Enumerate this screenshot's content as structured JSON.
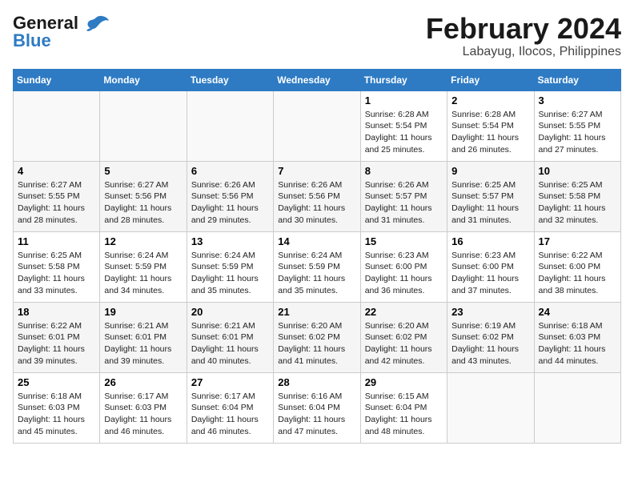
{
  "header": {
    "logo_line1": "General",
    "logo_line2": "Blue",
    "month": "February 2024",
    "location": "Labayug, Ilocos, Philippines"
  },
  "weekdays": [
    "Sunday",
    "Monday",
    "Tuesday",
    "Wednesday",
    "Thursday",
    "Friday",
    "Saturday"
  ],
  "weeks": [
    [
      {
        "day": "",
        "info": ""
      },
      {
        "day": "",
        "info": ""
      },
      {
        "day": "",
        "info": ""
      },
      {
        "day": "",
        "info": ""
      },
      {
        "day": "1",
        "info": "Sunrise: 6:28 AM\nSunset: 5:54 PM\nDaylight: 11 hours and 25 minutes."
      },
      {
        "day": "2",
        "info": "Sunrise: 6:28 AM\nSunset: 5:54 PM\nDaylight: 11 hours and 26 minutes."
      },
      {
        "day": "3",
        "info": "Sunrise: 6:27 AM\nSunset: 5:55 PM\nDaylight: 11 hours and 27 minutes."
      }
    ],
    [
      {
        "day": "4",
        "info": "Sunrise: 6:27 AM\nSunset: 5:55 PM\nDaylight: 11 hours and 28 minutes."
      },
      {
        "day": "5",
        "info": "Sunrise: 6:27 AM\nSunset: 5:56 PM\nDaylight: 11 hours and 28 minutes."
      },
      {
        "day": "6",
        "info": "Sunrise: 6:26 AM\nSunset: 5:56 PM\nDaylight: 11 hours and 29 minutes."
      },
      {
        "day": "7",
        "info": "Sunrise: 6:26 AM\nSunset: 5:56 PM\nDaylight: 11 hours and 30 minutes."
      },
      {
        "day": "8",
        "info": "Sunrise: 6:26 AM\nSunset: 5:57 PM\nDaylight: 11 hours and 31 minutes."
      },
      {
        "day": "9",
        "info": "Sunrise: 6:25 AM\nSunset: 5:57 PM\nDaylight: 11 hours and 31 minutes."
      },
      {
        "day": "10",
        "info": "Sunrise: 6:25 AM\nSunset: 5:58 PM\nDaylight: 11 hours and 32 minutes."
      }
    ],
    [
      {
        "day": "11",
        "info": "Sunrise: 6:25 AM\nSunset: 5:58 PM\nDaylight: 11 hours and 33 minutes."
      },
      {
        "day": "12",
        "info": "Sunrise: 6:24 AM\nSunset: 5:59 PM\nDaylight: 11 hours and 34 minutes."
      },
      {
        "day": "13",
        "info": "Sunrise: 6:24 AM\nSunset: 5:59 PM\nDaylight: 11 hours and 35 minutes."
      },
      {
        "day": "14",
        "info": "Sunrise: 6:24 AM\nSunset: 5:59 PM\nDaylight: 11 hours and 35 minutes."
      },
      {
        "day": "15",
        "info": "Sunrise: 6:23 AM\nSunset: 6:00 PM\nDaylight: 11 hours and 36 minutes."
      },
      {
        "day": "16",
        "info": "Sunrise: 6:23 AM\nSunset: 6:00 PM\nDaylight: 11 hours and 37 minutes."
      },
      {
        "day": "17",
        "info": "Sunrise: 6:22 AM\nSunset: 6:00 PM\nDaylight: 11 hours and 38 minutes."
      }
    ],
    [
      {
        "day": "18",
        "info": "Sunrise: 6:22 AM\nSunset: 6:01 PM\nDaylight: 11 hours and 39 minutes."
      },
      {
        "day": "19",
        "info": "Sunrise: 6:21 AM\nSunset: 6:01 PM\nDaylight: 11 hours and 39 minutes."
      },
      {
        "day": "20",
        "info": "Sunrise: 6:21 AM\nSunset: 6:01 PM\nDaylight: 11 hours and 40 minutes."
      },
      {
        "day": "21",
        "info": "Sunrise: 6:20 AM\nSunset: 6:02 PM\nDaylight: 11 hours and 41 minutes."
      },
      {
        "day": "22",
        "info": "Sunrise: 6:20 AM\nSunset: 6:02 PM\nDaylight: 11 hours and 42 minutes."
      },
      {
        "day": "23",
        "info": "Sunrise: 6:19 AM\nSunset: 6:02 PM\nDaylight: 11 hours and 43 minutes."
      },
      {
        "day": "24",
        "info": "Sunrise: 6:18 AM\nSunset: 6:03 PM\nDaylight: 11 hours and 44 minutes."
      }
    ],
    [
      {
        "day": "25",
        "info": "Sunrise: 6:18 AM\nSunset: 6:03 PM\nDaylight: 11 hours and 45 minutes."
      },
      {
        "day": "26",
        "info": "Sunrise: 6:17 AM\nSunset: 6:03 PM\nDaylight: 11 hours and 46 minutes."
      },
      {
        "day": "27",
        "info": "Sunrise: 6:17 AM\nSunset: 6:04 PM\nDaylight: 11 hours and 46 minutes."
      },
      {
        "day": "28",
        "info": "Sunrise: 6:16 AM\nSunset: 6:04 PM\nDaylight: 11 hours and 47 minutes."
      },
      {
        "day": "29",
        "info": "Sunrise: 6:15 AM\nSunset: 6:04 PM\nDaylight: 11 hours and 48 minutes."
      },
      {
        "day": "",
        "info": ""
      },
      {
        "day": "",
        "info": ""
      }
    ]
  ]
}
